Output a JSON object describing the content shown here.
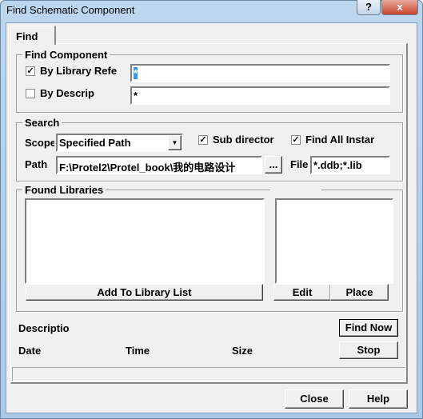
{
  "window": {
    "title": "Find Schematic Component",
    "help_label": "?",
    "close_label": "x"
  },
  "tabs": [
    {
      "label": "Find"
    }
  ],
  "find_component": {
    "group_label": "Find Component",
    "by_library_ref": {
      "label": "By Library Refe",
      "checked": true,
      "value": "*"
    },
    "by_description": {
      "label": "By Descrip",
      "checked": false,
      "value": "*"
    }
  },
  "search": {
    "group_label": "Search",
    "scope_label": "Scope",
    "scope_value": "Specified Path",
    "sub_directories": {
      "label": "Sub director",
      "checked": true
    },
    "find_all_instances": {
      "label": "Find All Instar",
      "checked": true
    },
    "path_label": "Path",
    "path_value": "F:\\Protel2\\Protel_book\\我的电路设计",
    "browse_label": "...",
    "file_label": "File",
    "file_value": "*.ddb;*.lib"
  },
  "found_libraries": {
    "group_label": "Found Libraries",
    "add_label": "Add To Library List",
    "edit_label": "Edit",
    "place_label": "Place"
  },
  "details": {
    "description_label": "Descriptio",
    "date_label": "Date",
    "time_label": "Time",
    "size_label": "Size"
  },
  "buttons": {
    "find_now": "Find Now",
    "stop": "Stop",
    "close": "Close",
    "help": "Help"
  }
}
